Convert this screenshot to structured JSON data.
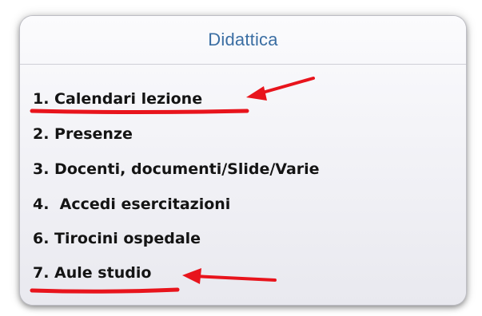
{
  "panel": {
    "title": "Didattica"
  },
  "menu": {
    "items": [
      {
        "label": "1. Calendari lezione"
      },
      {
        "label": "2. Presenze"
      },
      {
        "label": "3. Docenti, documenti/Slide/Varie"
      },
      {
        "label": "4.  Accedi esercitazioni"
      },
      {
        "label": "6. Tirocini ospedale"
      },
      {
        "label": "7. Aule studio"
      }
    ]
  },
  "annotations": {
    "color": "#e8141c"
  }
}
